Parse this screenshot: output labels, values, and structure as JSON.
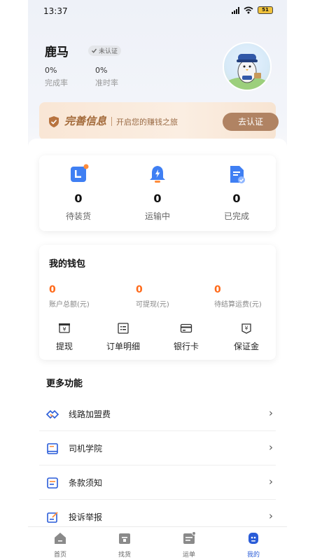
{
  "status_bar": {
    "time": "13:37",
    "battery": "51"
  },
  "profile": {
    "name": "鹿马",
    "cert_label": "未认证",
    "stats": [
      {
        "value": "0%",
        "label": "完成率"
      },
      {
        "value": "0%",
        "label": "准时率"
      }
    ]
  },
  "banner": {
    "title": "完善信息",
    "subtitle": "开启您的赚钱之旅",
    "button": "去认证"
  },
  "orders": [
    {
      "count": "0",
      "label": "待装货",
      "icon": "pending-load-icon"
    },
    {
      "count": "0",
      "label": "运输中",
      "icon": "in-transit-bell-icon"
    },
    {
      "count": "0",
      "label": "已完成",
      "icon": "completed-doc-icon"
    }
  ],
  "wallet": {
    "title": "我的钱包",
    "stats": [
      {
        "value": "0",
        "label": "账户总额(元)"
      },
      {
        "value": "0",
        "label": "可提现(元)"
      },
      {
        "value": "0",
        "label": "待结算运费(元)"
      }
    ],
    "actions": [
      {
        "label": "提现",
        "icon": "withdraw-icon"
      },
      {
        "label": "订单明细",
        "icon": "order-detail-icon"
      },
      {
        "label": "银行卡",
        "icon": "bank-card-icon"
      },
      {
        "label": "保证金",
        "icon": "deposit-icon"
      }
    ]
  },
  "more": {
    "title": "更多功能",
    "items": [
      {
        "label": "线路加盟费",
        "icon": "handshake-icon"
      },
      {
        "label": "司机学院",
        "icon": "book-icon"
      },
      {
        "label": "条款须知",
        "icon": "terms-icon"
      },
      {
        "label": "投诉举报",
        "icon": "complaint-icon"
      }
    ]
  },
  "tabs": [
    {
      "label": "首页",
      "icon": "home-icon"
    },
    {
      "label": "找货",
      "icon": "find-goods-icon"
    },
    {
      "label": "运单",
      "icon": "waybill-icon"
    },
    {
      "label": "我的",
      "icon": "profile-icon"
    }
  ],
  "colors": {
    "accent": "#2a5cd8",
    "money": "#ff6a1a",
    "banner_button": "#b08363"
  }
}
